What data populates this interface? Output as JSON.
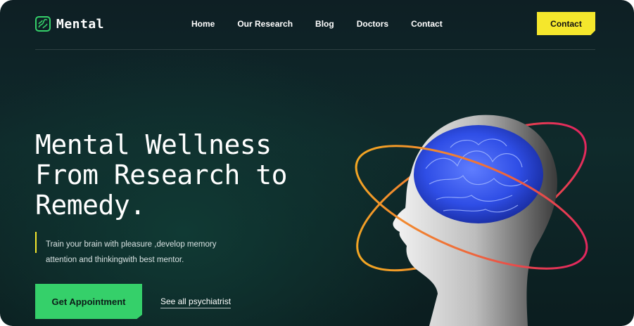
{
  "brand": {
    "name": "Mental"
  },
  "nav": {
    "items": [
      "Home",
      "Our Research",
      "Blog",
      "Doctors",
      "Contact"
    ],
    "cta_label": "Contact"
  },
  "hero": {
    "title_lines": [
      "Mental Wellness",
      "From Research to",
      "Remedy."
    ],
    "description_lines": [
      "Train your brain with pleasure ,develop memory",
      "attention and thinkingwith best mentor."
    ],
    "primary_button": "Get Appointment",
    "secondary_link": "See all psychiatrist"
  },
  "colors": {
    "background": "#0f2528",
    "accent_yellow": "#f5e72c",
    "accent_green": "#35d06a",
    "orbit_orange": "#f3a623",
    "orbit_pink": "#e2275e",
    "brain_blue": "#2f4ee6"
  },
  "icons": {
    "logo": "logo-icon"
  }
}
